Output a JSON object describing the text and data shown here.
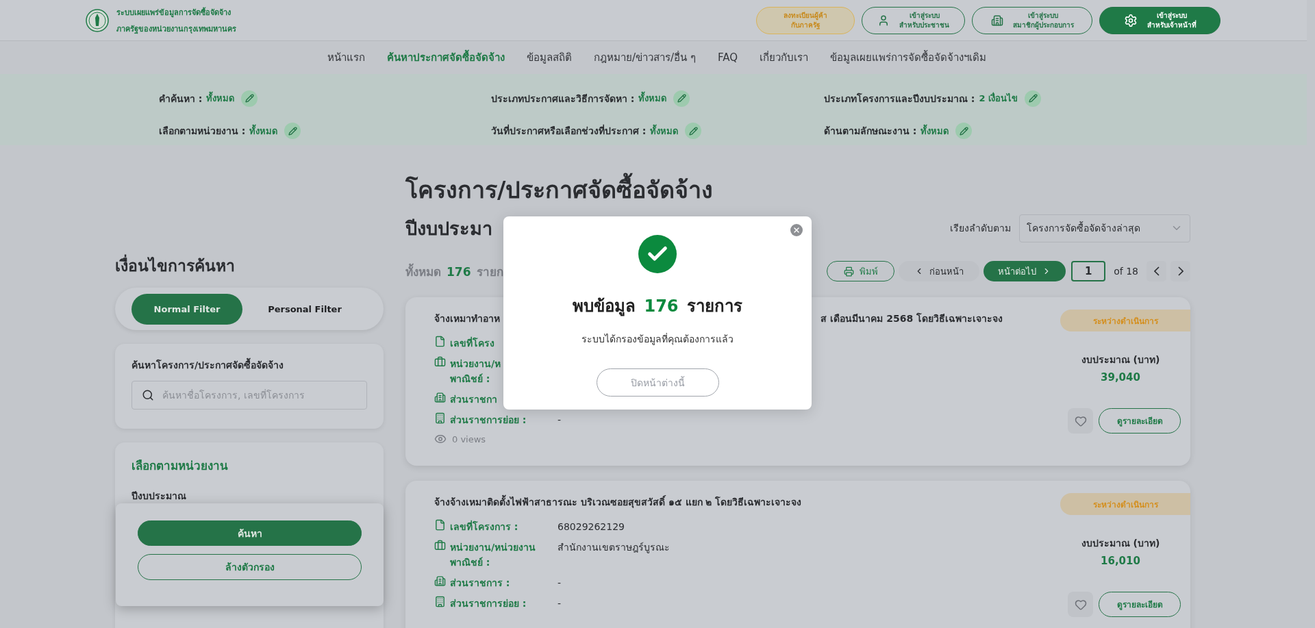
{
  "header": {
    "logo_lines": [
      "ระบบเผยแพร่ข้อมูลการจัดซื้อจัดจ้าง",
      "ภาครัฐของหน่วยงานกรุงเทพมหานคร"
    ],
    "buttons": [
      {
        "kind": "register",
        "lines": [
          "ลงทะเบียนผู้ค้า",
          "กับภาครัฐ"
        ]
      },
      {
        "kind": "citizen",
        "lines": [
          "เข้าสู่ระบบ",
          "สำหรับประชาชน"
        ]
      },
      {
        "kind": "member",
        "lines": [
          "เข้าสู่ระบบ",
          "สมาชิกผู้ประกอบการ"
        ]
      },
      {
        "kind": "officer",
        "lines": [
          "เข้าสู่ระบบ",
          "สำหรับเจ้าหน้าที่"
        ]
      }
    ]
  },
  "nav": [
    {
      "label": "หน้าแรก",
      "selected": false
    },
    {
      "label": "ค้นหาประกาศจัดซื้อจัดจ้าง",
      "selected": true
    },
    {
      "label": "ข้อมูลสถิติ",
      "selected": false
    },
    {
      "label": "กฎหมาย/ข่าวสาร/อื่น ๆ",
      "selected": false
    },
    {
      "label": "FAQ",
      "selected": false
    },
    {
      "label": "เกี่ยวกับเรา",
      "selected": false
    },
    {
      "label": "ข้อมูลเผยแพร่การจัดซื้อจัดจ้างฯเดิม",
      "selected": false
    }
  ],
  "filter_summary": [
    {
      "label": "คำค้นหา :",
      "value": "ทั้งหมด"
    },
    {
      "label": "ประเภทประกาศและวิธีการจัดหา :",
      "value": "ทั้งหมด"
    },
    {
      "label": "ประเภทโครงการและปีงบประมาณ :",
      "value": "2 เงื่อนไข"
    },
    {
      "label": "เลือกตามหน่วยงาน :",
      "value": "ทั้งหมด"
    },
    {
      "label": "วันที่ประกาศหรือเลือกช่วงที่ประกาศ :",
      "value": "ทั้งหมด"
    },
    {
      "label": "ด้านตามลักษณะงาน :",
      "value": "ทั้งหมด"
    }
  ],
  "sidebar": {
    "title": "เงื่อนไขการค้นหา",
    "tabs": [
      {
        "label": "Normal Filter",
        "selected": true
      },
      {
        "label": "Personal Filter",
        "selected": false
      }
    ],
    "search": {
      "label": "ค้นหาโครงการ/ประกาศจัดซื้อจัดจ้าง",
      "placeholder": "ค้นหาชื่อโครงการ, เลขที่โครงการ"
    },
    "unit": {
      "title": "เลือกตามหน่วยงาน",
      "field_label": "ปีงบประมาณ"
    },
    "actions": {
      "search": "ค้นหา",
      "clear": "ล้างตัวกรอง"
    }
  },
  "main": {
    "title": "โครงการ/ประกาศจัดซื้อจัดจ้าง",
    "subtitle": "ปีงบประมา",
    "sort": {
      "label": "เรียงลำดับตาม",
      "value": "โครงการจัดซื้อจัดจ้างล่าสุด"
    },
    "count": {
      "prefix": "ทั้งหมด",
      "number": "176",
      "suffix": "รายก"
    },
    "pagination": {
      "print": "พิมพ์",
      "prev": "ก่อนหน้า",
      "next": "หน้าต่อไป",
      "page": "1",
      "of": "of 18"
    }
  },
  "cards": [
    {
      "title_parts": [
        "จ้างเหมาทำอาห",
        "ส เดือนมีนาคม 2568 โดยวิธีเฉพาะเจาะจง"
      ],
      "status": "ระหว่างดำเนินการ",
      "budget_label": "งบประมาณ (บาท)",
      "budget": "39,040",
      "details": "ดูรายละเอียด",
      "views": "0 views",
      "fields": [
        {
          "kind": "document",
          "label_lines": [
            "เลขที่โครง"
          ]
        },
        {
          "kind": "briefcase",
          "label_lines": [
            "หน่วยงาน/ห",
            "พาณิชย์ :"
          ]
        },
        {
          "kind": "building",
          "label_lines": [
            "ส่วนราชกา"
          ]
        },
        {
          "kind": "office",
          "label_lines": [
            "ส่วนราชการย่อย :"
          ],
          "value": "-"
        }
      ]
    },
    {
      "title_parts": [
        "จ้างจ้างเหมาติดตั้งไฟฟ้าสาธารณะ บริเวณซอยสุขสวัสดิ์ ๑๕ แยก ๒ โดยวิธีเฉพาะเจาะจง"
      ],
      "status": "ระหว่างดำเนินการ",
      "budget_label": "งบประมาณ (บาท)",
      "budget": "16,010",
      "details": "ดูรายละเอียด",
      "fields": [
        {
          "kind": "document",
          "label_lines": [
            "เลขที่โครงการ :"
          ],
          "value": "68029262129"
        },
        {
          "kind": "briefcase",
          "label_lines": [
            "หน่วยงาน/หน่วยงาน",
            "พาณิชย์ :"
          ],
          "value": "สำนักงานเขตราษฎร์บูรณะ"
        },
        {
          "kind": "building",
          "label_lines": [
            "ส่วนราชการ :"
          ],
          "value": "-"
        },
        {
          "kind": "office",
          "label_lines": [
            "ส่วนราชการย่อย :"
          ],
          "value": "-"
        }
      ]
    }
  ],
  "modal": {
    "title_prefix": "พบข้อมูล",
    "count": "176",
    "title_suffix": "รายการ",
    "message": "ระบบได้กรองข้อมูลที่คุณต้องการแล้ว",
    "button": "ปิดหน้าต่างนี้"
  }
}
